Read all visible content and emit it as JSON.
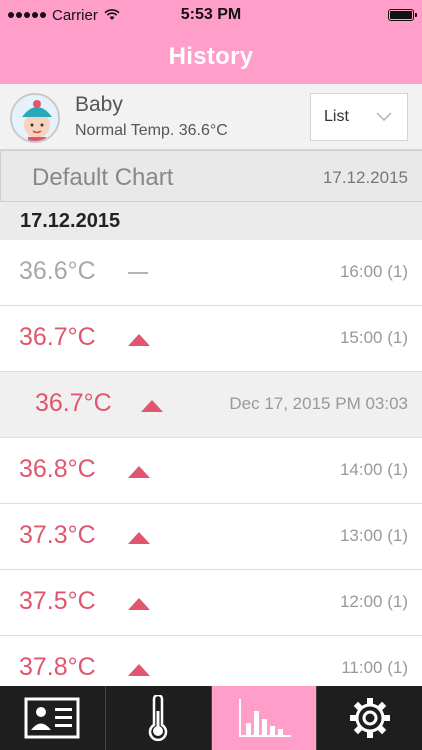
{
  "status": {
    "carrier": "Carrier",
    "time": "5:53 PM"
  },
  "nav": {
    "title": "History"
  },
  "profile": {
    "name": "Baby",
    "normal_temp": "Normal Temp. 36.6°C",
    "view_select": "List"
  },
  "chart_row": {
    "name": "Default Chart",
    "date": "17.12.2015"
  },
  "group": {
    "date": "17.12.2015"
  },
  "entries": [
    {
      "temp": "36.6°C",
      "trend": "same",
      "time": "16:00 (1)"
    },
    {
      "temp": "36.7°C",
      "trend": "up",
      "time": "15:00 (1)"
    },
    {
      "temp": "36.7°C",
      "trend": "up",
      "time": "Dec 17, 2015 PM 03:03"
    },
    {
      "temp": "36.8°C",
      "trend": "up",
      "time": "14:00 (1)"
    },
    {
      "temp": "37.3°C",
      "trend": "up",
      "time": "13:00 (1)"
    },
    {
      "temp": "37.5°C",
      "trend": "up",
      "time": "12:00 (1)"
    },
    {
      "temp": "37.8°C",
      "trend": "up",
      "time": "11:00 (1)"
    }
  ],
  "tabs": [
    {
      "icon": "profile-card-icon",
      "active": false
    },
    {
      "icon": "thermometer-icon",
      "active": false
    },
    {
      "icon": "bar-chart-icon",
      "active": true
    },
    {
      "icon": "gear-icon",
      "active": false
    }
  ],
  "colors": {
    "accent": "#ff9fc9",
    "rising": "#e0566e",
    "neutral": "#a8a8a8"
  }
}
